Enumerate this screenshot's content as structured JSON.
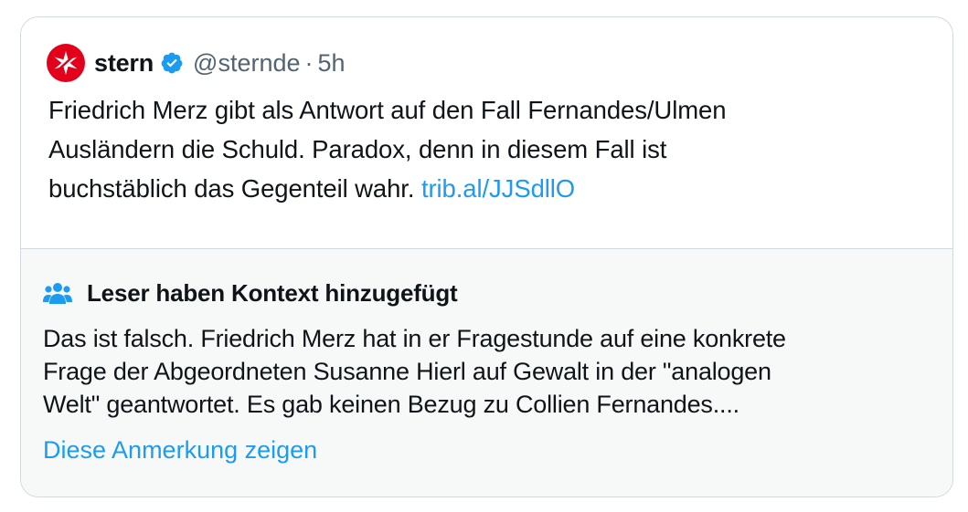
{
  "tweet": {
    "author_name": "stern",
    "handle": "@sternde",
    "separator": "·",
    "time": "5h",
    "text_lines": [
      "Friedrich Merz gibt als Antwort auf den Fall Fernandes/Ulmen",
      "Ausländern die Schuld. Paradox, denn in diesem Fall ist",
      "buchstäblich das Gegenteil wahr."
    ],
    "link": "trib.al/JJSdllO"
  },
  "community_note": {
    "title": "Leser haben Kontext hinzugefügt",
    "text_lines": [
      "Das ist falsch. Friedrich Merz hat in er Fragestunde auf eine konkrete",
      "Frage der Abgeordneten Susanne Hierl auf Gewalt in der \"analogen",
      "Welt\" geantwortet. Es gab keinen Bezug zu Collien Fernandes...."
    ],
    "show_note_label": "Diese Anmerkung zeigen"
  },
  "colors": {
    "brand_red": "#e2001a",
    "verified_blue": "#1d9bf0",
    "link_blue": "#1d9bf0",
    "secondary_text": "#536471",
    "note_background": "#f7f9f9"
  },
  "icons": {
    "logo": "stern-logo-icon",
    "verified": "verified-badge-icon",
    "context": "people-icon"
  }
}
